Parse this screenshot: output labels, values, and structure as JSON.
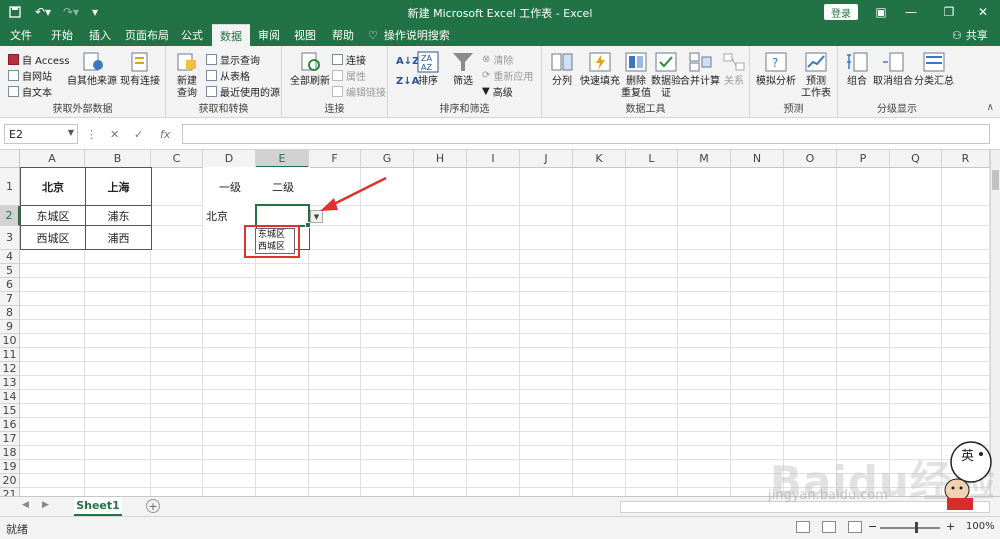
{
  "titlebar": {
    "title": "新建 Microsoft Excel 工作表 - Excel",
    "login": "登录"
  },
  "menu": {
    "tabs": [
      "文件",
      "开始",
      "插入",
      "页面布局",
      "公式",
      "数据",
      "审阅",
      "视图",
      "帮助"
    ],
    "active_tab": "数据",
    "tell_me": "操作说明搜索",
    "share": "共享"
  },
  "ribbon": {
    "ext_data": {
      "access": "自 Access",
      "web": "自网站",
      "text": "自文本",
      "other": "自其他来源",
      "existing": "现有连接",
      "label": "获取外部数据"
    },
    "get_transform": {
      "new_query_1": "新建",
      "new_query_2": "查询",
      "show_queries": "显示查询",
      "from_table": "从表格",
      "recent": "最近使用的源",
      "label": "获取和转换"
    },
    "connections": {
      "refresh_all": "全部刷新",
      "connections": "连接",
      "properties": "属性",
      "edit_links": "编辑链接",
      "label": "连接"
    },
    "sort_filter": {
      "sort": "排序",
      "filter": "筛选",
      "clear": "清除",
      "reapply": "重新应用",
      "advanced": "高级",
      "label": "排序和筛选"
    },
    "data_tools": {
      "text_to_cols": "分列",
      "flash_fill": "快速填充",
      "remove_dup_1": "删除",
      "remove_dup_2": "重复值",
      "validation_1": "数据验",
      "validation_2": "证",
      "consolidate": "合并计算",
      "relationships": "关系",
      "label": "数据工具"
    },
    "forecast": {
      "what_if": "模拟分析",
      "sheet_1": "预测",
      "sheet_2": "工作表",
      "label": "预测"
    },
    "outline": {
      "group": "组合",
      "ungroup": "取消组合",
      "subtotal": "分类汇总",
      "label": "分级显示"
    }
  },
  "formula_bar": {
    "name_box": "E2",
    "fx": "fx",
    "value": ""
  },
  "grid": {
    "columns": [
      "A",
      "B",
      "C",
      "D",
      "E",
      "F",
      "G",
      "H",
      "I",
      "J",
      "K",
      "L",
      "M",
      "N",
      "O",
      "P",
      "Q",
      "R"
    ],
    "selected_column": "E",
    "rows": [
      "1",
      "2",
      "3",
      "4",
      "5",
      "6",
      "7",
      "8",
      "9",
      "10",
      "11",
      "12",
      "13",
      "14",
      "15",
      "16",
      "17",
      "18",
      "19",
      "20",
      "21"
    ],
    "selected_row": "2",
    "cells": {
      "A1": "北京",
      "B1": "上海",
      "A2": "东城区",
      "B2": "浦东",
      "A3": "西城区",
      "B3": "浦西",
      "D1": "一级",
      "E1": "二级",
      "D2": "北京"
    },
    "dropdown_options": [
      "东城区",
      "西城区"
    ]
  },
  "sheets": {
    "tabs": [
      "Sheet1"
    ],
    "active": "Sheet1"
  },
  "status": {
    "ready": "就绪",
    "zoom": "100%"
  },
  "watermark": {
    "brand": "Baidu经验",
    "url": "jingyan.baidu.com",
    "mascot_text": "英"
  }
}
